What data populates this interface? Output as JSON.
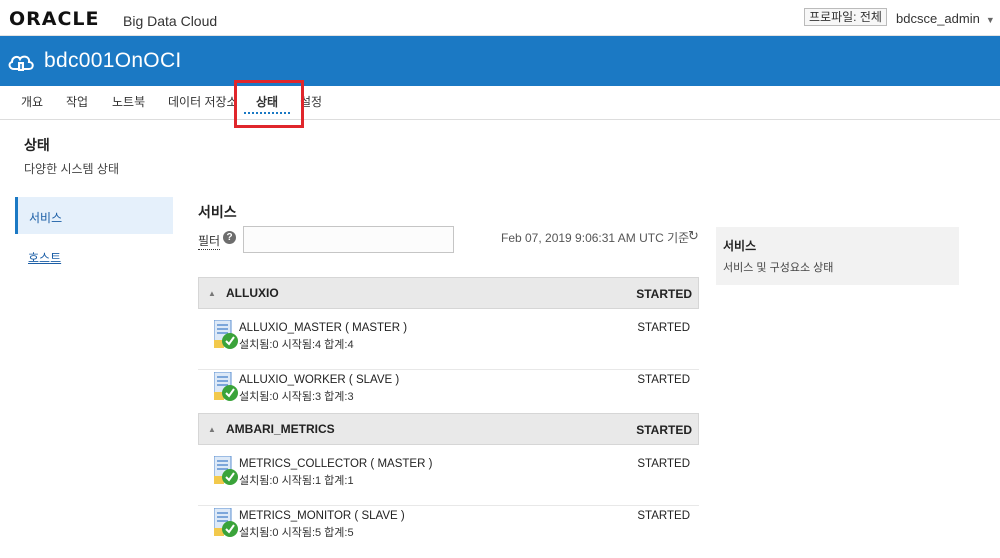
{
  "header": {
    "logo": "ORACLE",
    "product": "Big Data Cloud",
    "profile_label": "프로파일: 전체",
    "user": "bdcsce_admin"
  },
  "banner": {
    "title": "bdc001OnOCI",
    "icon": "cloud-icon"
  },
  "tabs": [
    {
      "label": "개요"
    },
    {
      "label": "작업"
    },
    {
      "label": "노트북"
    },
    {
      "label": "데이터 저장소"
    },
    {
      "label": "상태",
      "active": true
    },
    {
      "label": "설정"
    }
  ],
  "page": {
    "title": "상태",
    "subtitle": "다양한 시스템 상태"
  },
  "sidebar": {
    "items": [
      {
        "label": "서비스",
        "active": true
      },
      {
        "label": "호스트"
      }
    ]
  },
  "main": {
    "section_title": "서비스",
    "filter_label": "필터",
    "filter_value": "",
    "timestamp": "Feb 07, 2019 9:06:31 AM UTC 기준",
    "groups": [
      {
        "name": "ALLUXIO",
        "status": "STARTED",
        "services": [
          {
            "name": "ALLUXIO_MASTER ( MASTER )",
            "detail": "설치됨:0 시작됨:4 합계:4",
            "status": "STARTED"
          },
          {
            "name": "ALLUXIO_WORKER ( SLAVE )",
            "detail": "설치됨:0 시작됨:3 합계:3",
            "status": "STARTED"
          }
        ]
      },
      {
        "name": "AMBARI_METRICS",
        "status": "STARTED",
        "services": [
          {
            "name": "METRICS_COLLECTOR ( MASTER )",
            "detail": "설치됨:0 시작됨:1 합계:1",
            "status": "STARTED"
          },
          {
            "name": "METRICS_MONITOR ( SLAVE )",
            "detail": "설치됨:0 시작됨:5 합계:5",
            "status": "STARTED"
          }
        ]
      }
    ]
  },
  "info_panel": {
    "title": "서비스",
    "description": "서비스 및 구성요소 상태"
  },
  "colors": {
    "brand_blue": "#1b79c4",
    "highlight_red": "#e0262b",
    "ok_green": "#3aa33a"
  }
}
